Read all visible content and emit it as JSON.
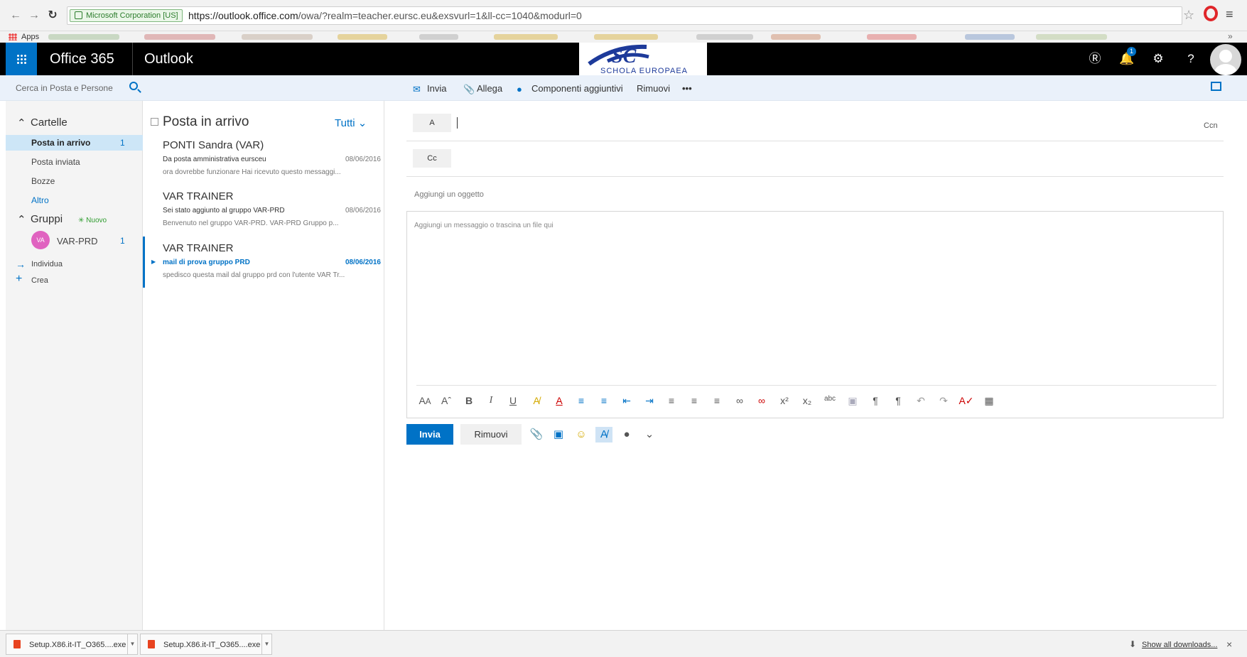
{
  "browser": {
    "secure_label": "Microsoft Corporation [US]",
    "url_host": "https://outlook.office.com",
    "url_path": "/owa/?realm=teacher.eursc.eu&exsvurl=1&ll-cc=1040&modurl=0",
    "apps_label": "Apps",
    "bookmarks_more": "»",
    "icons": [
      "back-icon",
      "forward-icon",
      "reload-icon",
      "lock-icon",
      "star-icon",
      "opera-icon",
      "menu-icon"
    ]
  },
  "header": {
    "brand": "Office 365",
    "app": "Outlook",
    "logo_text": "SCHOLA EUROPAEA",
    "notification_count": "1",
    "colors": {
      "brand_blue": "#0072c6",
      "header_bg": "#000000"
    }
  },
  "commands": {
    "search_placeholder": "Cerca in Posta e Persone",
    "send": "Invia",
    "attach": "Allega",
    "addins": "Componenti aggiuntivi",
    "discard": "Rimuovi",
    "more": "•••"
  },
  "folders": {
    "heading": "Cartelle",
    "items": [
      {
        "label": "Posta in arrivo",
        "count": "1",
        "selected": true
      },
      {
        "label": "Posta inviata",
        "count": ""
      },
      {
        "label": "Bozze",
        "count": ""
      },
      {
        "label": "Altro",
        "count": ""
      }
    ],
    "groups_heading": "Gruppi",
    "new_group": "Nuovo",
    "group": {
      "initials": "VA",
      "name": "VAR-PRD",
      "count": "1"
    },
    "discover": "Individua",
    "create": "Crea"
  },
  "message_list": {
    "title": "Posta in arrivo",
    "filter": "Tutti",
    "messages": [
      {
        "sender": "PONTI Sandra (VAR)",
        "subject": "Da posta amministrativa eursceu",
        "date": "08/06/2016",
        "preview": "ora dovrebbe funzionare  Hai ricevuto questo messaggi..."
      },
      {
        "sender": "VAR TRAINER",
        "subject": "Sei stato aggiunto al gruppo VAR-PRD",
        "date": "08/06/2016",
        "preview": "Benvenuto nel gruppo VAR-PRD.   VAR-PRD Gruppo p..."
      },
      {
        "sender": "VAR TRAINER",
        "subject": "mail di prova gruppo PRD",
        "date": "08/06/2016",
        "preview": "spedisco questa mail dal gruppo prd con l'utente VAR Tr...",
        "selected": true
      }
    ]
  },
  "compose": {
    "to_label": "A",
    "cc_label": "Cc",
    "bcc_label": "Ccn",
    "subject_placeholder": "Aggiungi un oggetto",
    "body_placeholder": "Aggiungi un messaggio o trascina un file qui",
    "send": "Invia",
    "discard": "Rimuovi"
  },
  "downloads": {
    "items": [
      "Setup.X86.it-IT_O365....exe",
      "Setup.X86.it-IT_O365....exe"
    ],
    "show_all": "Show all downloads...",
    "close": "×"
  }
}
